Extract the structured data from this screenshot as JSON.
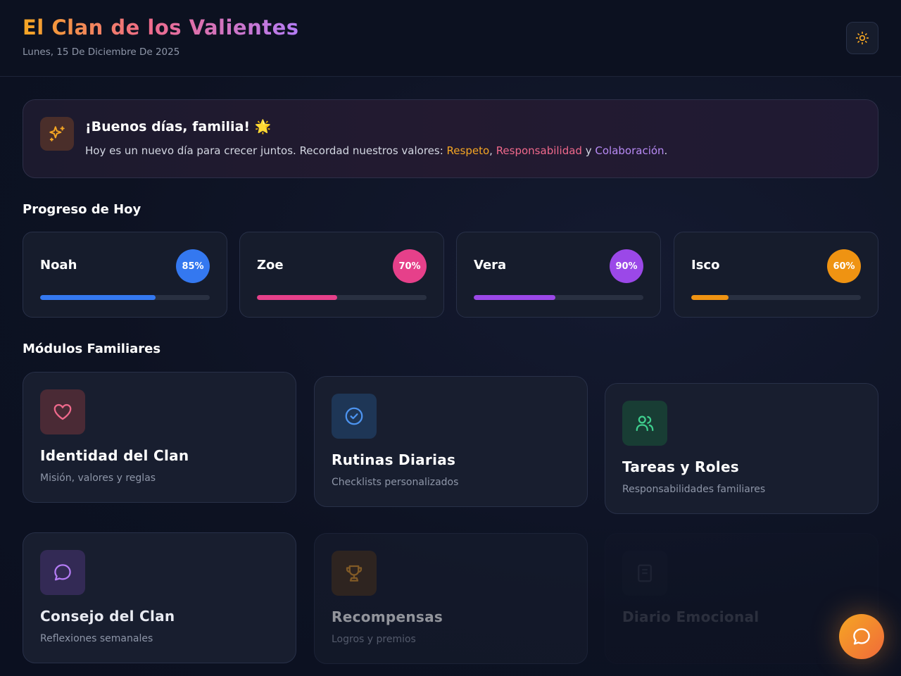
{
  "header": {
    "title": "El Clan de los Valientes",
    "date": "Lunes, 15 De Diciembre De 2025",
    "theme_icon": "sun-icon"
  },
  "greeting": {
    "icon": "sparkles-icon",
    "title": "¡Buenos días, familia! 🌟",
    "text_before": "Hoy es un nuevo día para crecer juntos. Recordad nuestros valores: ",
    "value1": "Respeto",
    "sep1": ", ",
    "value2": "Responsabilidad",
    "sep2": " y ",
    "value3": "Colaboración",
    "end": ".",
    "colors": {
      "value1": "#f5a623",
      "value2": "#f0698c",
      "value3": "#b88af5"
    }
  },
  "progress": {
    "title": "Progreso de Hoy",
    "members": [
      {
        "name": "Noah",
        "percent_label": "85%",
        "bar_fill": 0.68,
        "color": "#3478f0"
      },
      {
        "name": "Zoe",
        "percent_label": "70%",
        "bar_fill": 0.475,
        "color": "#e6408a"
      },
      {
        "name": "Vera",
        "percent_label": "90%",
        "bar_fill": 0.48,
        "color": "#9b48e8"
      },
      {
        "name": "Isco",
        "percent_label": "60%",
        "bar_fill": 0.22,
        "color": "#ef9312"
      }
    ]
  },
  "modules": {
    "title": "Módulos Familiares",
    "items": [
      {
        "title": "Identidad del Clan",
        "subtitle": "Misión, valores y reglas",
        "icon": "heart-icon",
        "color": "#f0698c"
      },
      {
        "title": "Rutinas Diarias",
        "subtitle": "Checklists personalizados",
        "icon": "check-circle-icon",
        "color": "#4d94f0"
      },
      {
        "title": "Tareas y Roles",
        "subtitle": "Responsabilidades familiares",
        "icon": "users-icon",
        "color": "#3fcf8e"
      },
      {
        "title": "Consejo del Clan",
        "subtitle": "Reflexiones semanales",
        "icon": "chat-bubble-icon",
        "color": "#b47cf5"
      },
      {
        "title": "Recompensas",
        "subtitle": "Logros y premios",
        "icon": "trophy-icon",
        "color": "#e0952a"
      },
      {
        "title": "Diario Emocional",
        "subtitle": "",
        "icon": "journal-icon",
        "color": "#8e96a8"
      }
    ]
  },
  "chat": {
    "icon": "chat-bubble-icon",
    "color": "#f57a30"
  }
}
